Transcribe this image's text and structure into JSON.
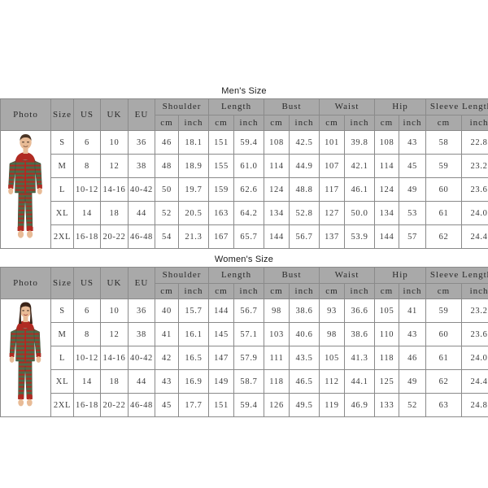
{
  "tables": [
    {
      "id": "mens",
      "title": "Men's Size",
      "photo_alt": "man-in-striped-onesie-pajama",
      "headers": {
        "photo": "Photo",
        "size": "Size",
        "us": "US",
        "uk": "UK",
        "eu": "EU",
        "groups": [
          {
            "label": "Shoulder",
            "sub": [
              "cm",
              "inch"
            ]
          },
          {
            "label": "Length",
            "sub": [
              "cm",
              "inch"
            ]
          },
          {
            "label": "Bust",
            "sub": [
              "cm",
              "inch"
            ]
          },
          {
            "label": "Waist",
            "sub": [
              "cm",
              "inch"
            ]
          },
          {
            "label": "Hip",
            "sub": [
              "cm",
              "inch"
            ]
          },
          {
            "label": "Sleeve Length",
            "sub": [
              "cm",
              "inch"
            ]
          }
        ]
      },
      "rows": [
        {
          "size": "S",
          "us": "6",
          "uk": "10",
          "eu": "36",
          "shoulder_cm": "46",
          "shoulder_in": "18.1",
          "length_cm": "151",
          "length_in": "59.4",
          "bust_cm": "108",
          "bust_in": "42.5",
          "waist_cm": "101",
          "waist_in": "39.8",
          "hip_cm": "108",
          "hip_in": "43",
          "sleeve_cm": "58",
          "sleeve_in": "22.8"
        },
        {
          "size": "M",
          "us": "8",
          "uk": "12",
          "eu": "38",
          "shoulder_cm": "48",
          "shoulder_in": "18.9",
          "length_cm": "155",
          "length_in": "61.0",
          "bust_cm": "114",
          "bust_in": "44.9",
          "waist_cm": "107",
          "waist_in": "42.1",
          "hip_cm": "114",
          "hip_in": "45",
          "sleeve_cm": "59",
          "sleeve_in": "23.2"
        },
        {
          "size": "L",
          "us": "10-12",
          "uk": "14-16",
          "eu": "40-42",
          "shoulder_cm": "50",
          "shoulder_in": "19.7",
          "length_cm": "159",
          "length_in": "62.6",
          "bust_cm": "124",
          "bust_in": "48.8",
          "waist_cm": "117",
          "waist_in": "46.1",
          "hip_cm": "124",
          "hip_in": "49",
          "sleeve_cm": "60",
          "sleeve_in": "23.6"
        },
        {
          "size": "XL",
          "us": "14",
          "uk": "18",
          "eu": "44",
          "shoulder_cm": "52",
          "shoulder_in": "20.5",
          "length_cm": "163",
          "length_in": "64.2",
          "bust_cm": "134",
          "bust_in": "52.8",
          "waist_cm": "127",
          "waist_in": "50.0",
          "hip_cm": "134",
          "hip_in": "53",
          "sleeve_cm": "61",
          "sleeve_in": "24.0"
        },
        {
          "size": "2XL",
          "us": "16-18",
          "uk": "20-22",
          "eu": "46-48",
          "shoulder_cm": "54",
          "shoulder_in": "21.3",
          "length_cm": "167",
          "length_in": "65.7",
          "bust_cm": "144",
          "bust_in": "56.7",
          "waist_cm": "137",
          "waist_in": "53.9",
          "hip_cm": "144",
          "hip_in": "57",
          "sleeve_cm": "62",
          "sleeve_in": "24.4"
        }
      ]
    },
    {
      "id": "womens",
      "title": "Women's Size",
      "photo_alt": "woman-in-striped-onesie-pajama",
      "headers": {
        "photo": "Photo",
        "size": "Size",
        "us": "US",
        "uk": "UK",
        "eu": "EU",
        "groups": [
          {
            "label": "Shoulder",
            "sub": [
              "cm",
              "inch"
            ]
          },
          {
            "label": "Length",
            "sub": [
              "cm",
              "inch"
            ]
          },
          {
            "label": "Bust",
            "sub": [
              "cm",
              "inch"
            ]
          },
          {
            "label": "Waist",
            "sub": [
              "cm",
              "inch"
            ]
          },
          {
            "label": "Hip",
            "sub": [
              "cm",
              "inch"
            ]
          },
          {
            "label": "Sleeve Length",
            "sub": [
              "cm",
              "inch"
            ]
          }
        ]
      },
      "rows": [
        {
          "size": "S",
          "us": "6",
          "uk": "10",
          "eu": "36",
          "shoulder_cm": "40",
          "shoulder_in": "15.7",
          "length_cm": "144",
          "length_in": "56.7",
          "bust_cm": "98",
          "bust_in": "38.6",
          "waist_cm": "93",
          "waist_in": "36.6",
          "hip_cm": "105",
          "hip_in": "41",
          "sleeve_cm": "59",
          "sleeve_in": "23.2"
        },
        {
          "size": "M",
          "us": "8",
          "uk": "12",
          "eu": "38",
          "shoulder_cm": "41",
          "shoulder_in": "16.1",
          "length_cm": "145",
          "length_in": "57.1",
          "bust_cm": "103",
          "bust_in": "40.6",
          "waist_cm": "98",
          "waist_in": "38.6",
          "hip_cm": "110",
          "hip_in": "43",
          "sleeve_cm": "60",
          "sleeve_in": "23.6"
        },
        {
          "size": "L",
          "us": "10-12",
          "uk": "14-16",
          "eu": "40-42",
          "shoulder_cm": "42",
          "shoulder_in": "16.5",
          "length_cm": "147",
          "length_in": "57.9",
          "bust_cm": "111",
          "bust_in": "43.5",
          "waist_cm": "105",
          "waist_in": "41.3",
          "hip_cm": "118",
          "hip_in": "46",
          "sleeve_cm": "61",
          "sleeve_in": "24.0"
        },
        {
          "size": "XL",
          "us": "14",
          "uk": "18",
          "eu": "44",
          "shoulder_cm": "43",
          "shoulder_in": "16.9",
          "length_cm": "149",
          "length_in": "58.7",
          "bust_cm": "118",
          "bust_in": "46.5",
          "waist_cm": "112",
          "waist_in": "44.1",
          "hip_cm": "125",
          "hip_in": "49",
          "sleeve_cm": "62",
          "sleeve_in": "24.4"
        },
        {
          "size": "2XL",
          "us": "16-18",
          "uk": "20-22",
          "eu": "46-48",
          "shoulder_cm": "45",
          "shoulder_in": "17.7",
          "length_cm": "151",
          "length_in": "59.4",
          "bust_cm": "126",
          "bust_in": "49.5",
          "waist_cm": "119",
          "waist_in": "46.9",
          "hip_cm": "133",
          "hip_in": "52",
          "sleeve_cm": "63",
          "sleeve_in": "24.8"
        }
      ]
    }
  ],
  "colors": {
    "header_bg": "#a9a9a9",
    "border": "#8a8a8a",
    "text": "#3a3a3a",
    "stripe_green": "#4b6b4a",
    "stripe_red": "#b02a22",
    "skin": "#e8bb96",
    "hair_men": "#4a3526",
    "hair_women": "#3a2418"
  }
}
